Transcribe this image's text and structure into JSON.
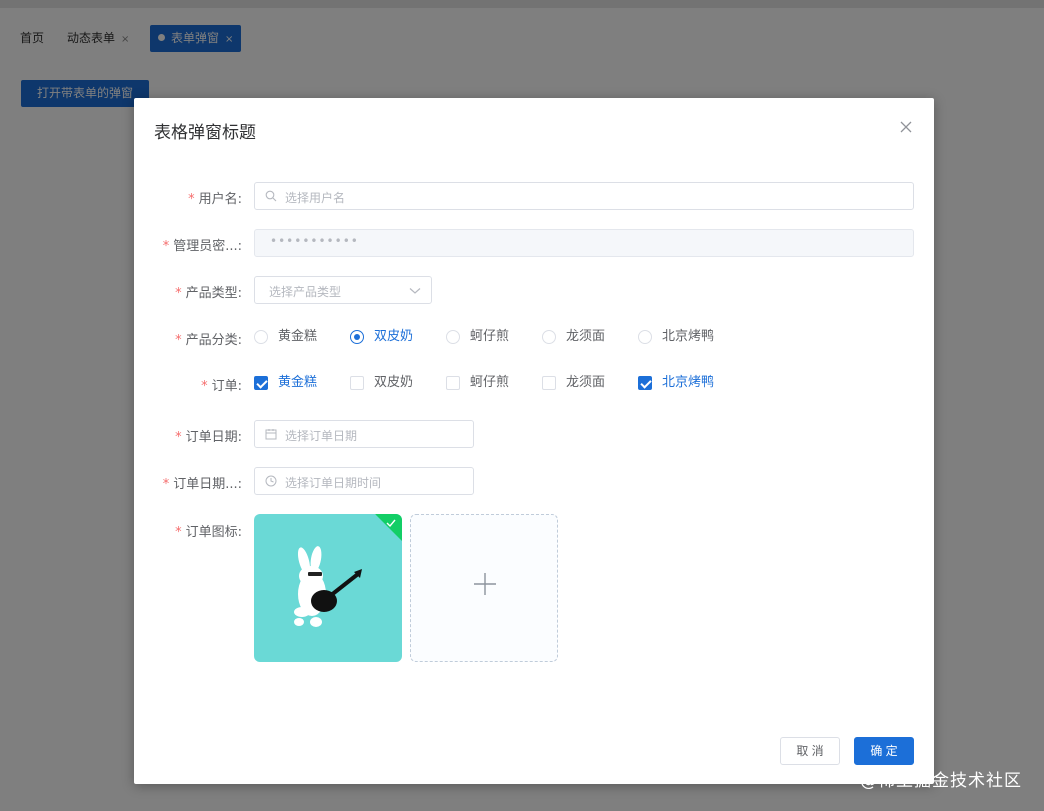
{
  "tabs": [
    {
      "label": "首页",
      "closable": false
    },
    {
      "label": "动态表单",
      "closable": true,
      "close": "×"
    },
    {
      "label": "表单弹窗",
      "closable": true,
      "close": "×",
      "active": true
    }
  ],
  "page": {
    "open_button": "打开带表单的弹窗"
  },
  "dialog": {
    "title": "表格弹窗标题",
    "fields": {
      "username": {
        "label": "用户名:",
        "placeholder": "选择用户名",
        "required": true
      },
      "admin_password": {
        "label": "管理员密...:",
        "value": "•••••••••••",
        "required": true
      },
      "product_type": {
        "label": "产品类型:",
        "placeholder": "选择产品类型",
        "required": true
      },
      "product_category": {
        "label": "产品分类:",
        "required": true,
        "options": [
          "黄金糕",
          "双皮奶",
          "蚵仔煎",
          "龙须面",
          "北京烤鸭"
        ],
        "selected": "双皮奶"
      },
      "order": {
        "label": "订单:",
        "required": true,
        "options": [
          "黄金糕",
          "双皮奶",
          "蚵仔煎",
          "龙须面",
          "北京烤鸭"
        ],
        "checked": [
          "黄金糕",
          "北京烤鸭"
        ]
      },
      "order_date": {
        "label": "订单日期:",
        "placeholder": "选择订单日期",
        "required": true
      },
      "order_datetime": {
        "label": "订单日期...:",
        "placeholder": "选择订单日期时间",
        "required": true
      },
      "order_icon": {
        "label": "订单图标:",
        "required": true
      }
    },
    "footer": {
      "cancel": "取 消",
      "confirm": "确 定"
    }
  },
  "watermark": "@稀土掘金技术社区",
  "colors": {
    "primary": "#1c6fd8",
    "required": "#f56c6c",
    "upload_bg": "#6ad9d6",
    "success": "#13ce66"
  }
}
